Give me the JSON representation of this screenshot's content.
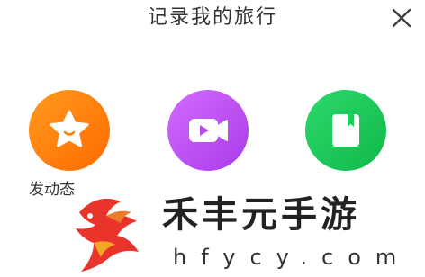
{
  "header": {
    "title": "记录我的旅行",
    "close_icon": "close-icon"
  },
  "actions": [
    {
      "id": "moment",
      "label": "发动态",
      "icon": "star-smile-icon",
      "color": "#FF7A00"
    },
    {
      "id": "video",
      "label": "",
      "icon": "video-camera-icon",
      "color": "#C34BF0"
    },
    {
      "id": "note",
      "label": "",
      "icon": "notebook-icon",
      "color": "#1FCB5C"
    }
  ],
  "watermark": {
    "text": "禾丰元手游",
    "url": "hfycy.com"
  }
}
